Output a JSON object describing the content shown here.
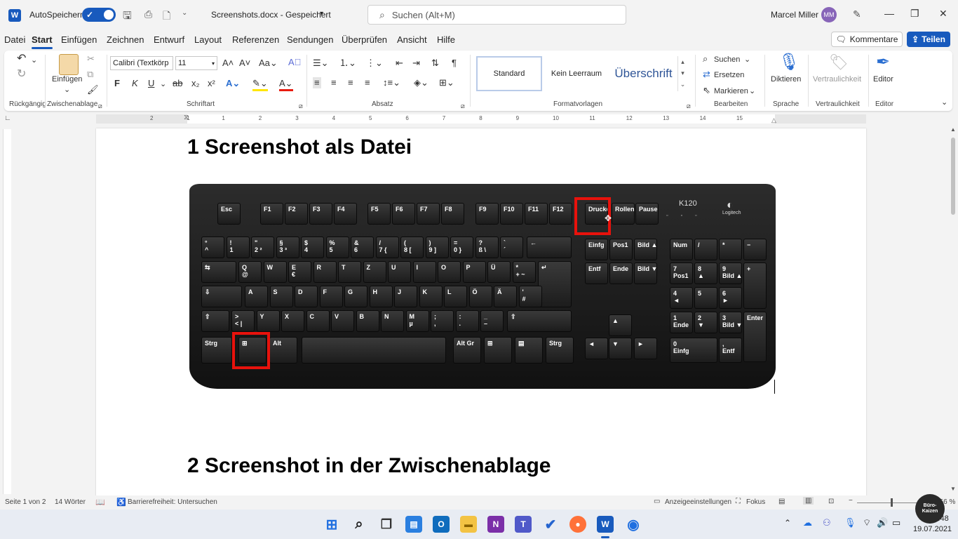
{
  "titlebar": {
    "app_icon": "word-icon",
    "autosave_label": "AutoSpeichern",
    "autosave_on": true,
    "doc_title": "Screenshots.docx  -  Gespeichert",
    "search_placeholder": "Suchen (Alt+M)",
    "user_name": "Marcel Miller",
    "user_initials": "MM"
  },
  "menu": {
    "tabs": [
      "Datei",
      "Start",
      "Einfügen",
      "Zeichnen",
      "Entwurf",
      "Layout",
      "Referenzen",
      "Sendungen",
      "Überprüfen",
      "Ansicht",
      "Hilfe"
    ],
    "active": "Start",
    "comments": "Kommentare",
    "share": "Teilen"
  },
  "ribbon": {
    "groups": {
      "undo": "Rückgängig",
      "clipboard": "Zwischenablage",
      "font": "Schriftart",
      "paragraph": "Absatz",
      "styles": "Formatvorlagen",
      "editing": "Bearbeiten",
      "voice": "Sprache",
      "sensitivity": "Vertraulichkeit",
      "editor": "Editor"
    },
    "paste": "Einfügen",
    "font_name": "Calibri (Textkörp",
    "font_size": "11",
    "styles": [
      "Standard",
      "Kein Leerraum",
      "Überschrift"
    ],
    "find": "Suchen",
    "replace": "Ersetzen",
    "select": "Markieren",
    "dictate": "Diktieren",
    "sensitivity": "Vertraulichkeit",
    "editor": "Editor",
    "font_buttons": [
      "F",
      "K",
      "U",
      "ab",
      "x₂",
      "x²"
    ]
  },
  "ruler": {
    "marks": [
      "2",
      "1",
      "1",
      "2",
      "3",
      "4",
      "5",
      "6",
      "7",
      "8",
      "9",
      "10",
      "11",
      "12",
      "13",
      "14",
      "15"
    ]
  },
  "document": {
    "heading1": "1 Screenshot als Datei",
    "heading2": "2 Screenshot in der Zwischenablage",
    "image": {
      "brand": "K120",
      "logo_text": "Logitech",
      "highlighted_keys": [
        "Drucken",
        "Windows"
      ]
    }
  },
  "keyboard": {
    "fkeys": [
      "Esc",
      "F1",
      "F2",
      "F3",
      "F4",
      "F5",
      "F6",
      "F7",
      "F8",
      "F9",
      "F10",
      "F11",
      "F12",
      "Drucken",
      "Rollen",
      "Pause Unterbr"
    ],
    "row1": [
      "°\n^",
      "!\n1",
      "\"\n2 ²",
      "§\n3 ³",
      "$\n4",
      "%\n5",
      "&\n6",
      "/\n7 {",
      "(\n8 [",
      ")\n9 ]",
      "=\n0 }",
      "?\nß \\",
      "`\n´"
    ],
    "row2": [
      "Q\n@",
      "W",
      "E\n€",
      "R",
      "T",
      "Z",
      "U",
      "I",
      "O",
      "P",
      "Ü",
      "*\n+ ~"
    ],
    "row3": [
      "A",
      "S",
      "D",
      "F",
      "G",
      "H",
      "J",
      "K",
      "L",
      "Ö",
      "Ä",
      "'\n#"
    ],
    "row4": [
      ">\n< |",
      "Y",
      "X",
      "C",
      "V",
      "B",
      "N",
      "M\nµ",
      ";\n,",
      ":\n.",
      "_\n–"
    ],
    "bottom": [
      "Strg",
      "Alt",
      "Alt Gr",
      "Strg"
    ],
    "nav": [
      "Einfg",
      "Pos1",
      "Bild ▲",
      "Entf",
      "Ende",
      "Bild ▼"
    ],
    "numpad": [
      "Num",
      "/",
      "*",
      "−",
      "7\nPos1",
      "8\n▲",
      "9\nBild ▲",
      "+",
      "4\n◄",
      "5",
      "6\n►",
      "1\nEnde",
      "2\n▼",
      "3\nBild ▼",
      "Enter",
      "0\nEinfg",
      ",\nEntf"
    ]
  },
  "statusbar": {
    "page": "Seite 1 von 2",
    "words": "14 Wörter",
    "accessibility": "Barrierefreiheit: Untersuchen",
    "display_settings": "Anzeigeeinstellungen",
    "focus": "Fokus",
    "zoom": "156 %"
  },
  "taskbar": {
    "time": "11:48",
    "date": "19.07.2021",
    "badge_text": "Büro-Kaizen"
  },
  "colors": {
    "accent": "#185abd",
    "highlight": "#e8120c",
    "word": "#185abd"
  }
}
